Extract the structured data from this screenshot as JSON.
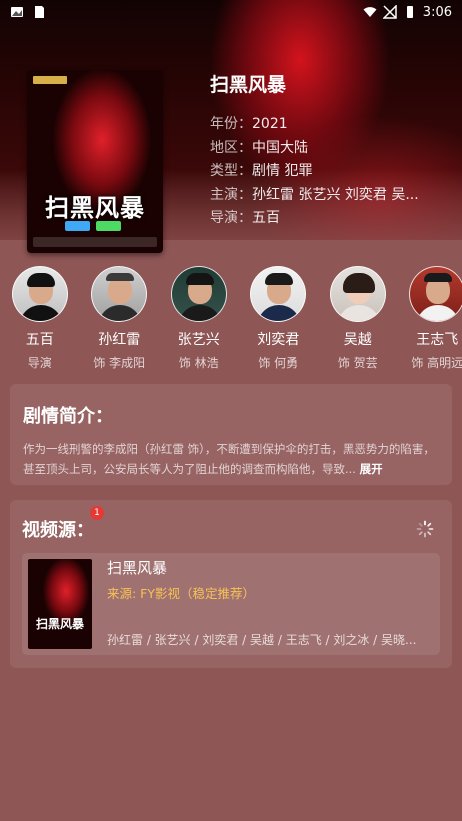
{
  "status_bar": {
    "time": "3:06"
  },
  "movie": {
    "title": "扫黑风暴",
    "poster_title": "扫黑风暴",
    "year_label": "年份：",
    "year": "2021",
    "region_label": "地区：",
    "region": "中国大陆",
    "genre_label": "类型：",
    "genre": "剧情 犯罪",
    "cast_label": "主演：",
    "cast": "孙红雷 张艺兴 刘奕君 吴...",
    "director_label": "导演：",
    "director": "五百"
  },
  "cast_list": [
    {
      "name": "五百",
      "role": "导演"
    },
    {
      "name": "孙红雷",
      "role": "饰 李成阳"
    },
    {
      "name": "张艺兴",
      "role": "饰 林浩"
    },
    {
      "name": "刘奕君",
      "role": "饰 何勇"
    },
    {
      "name": "吴越",
      "role": "饰 贺芸"
    },
    {
      "name": "王志飞",
      "role": "饰 高明远"
    }
  ],
  "synopsis": {
    "title": "剧情简介：",
    "text": "作为一线刑警的李成阳（孙红雷 饰），不断遭到保护伞的打击，黑恶势力的陷害，甚至顶头上司，公安局长等人为了阻止他的调查而构陷他，导致...",
    "expand_label": "展开"
  },
  "sources": {
    "title": "视频源：",
    "badge_count": "1",
    "items": [
      {
        "title": "扫黑风暴",
        "from": "来源: FY影视（稳定推荐）",
        "cast": "孙红雷 / 张艺兴 / 刘奕君 / 吴越 / 王志飞 / 刘之冰 / 吴晓..."
      }
    ]
  },
  "colors": {
    "background": "#8f5656",
    "source_highlight": "#f7c356",
    "badge": "#e53935"
  }
}
